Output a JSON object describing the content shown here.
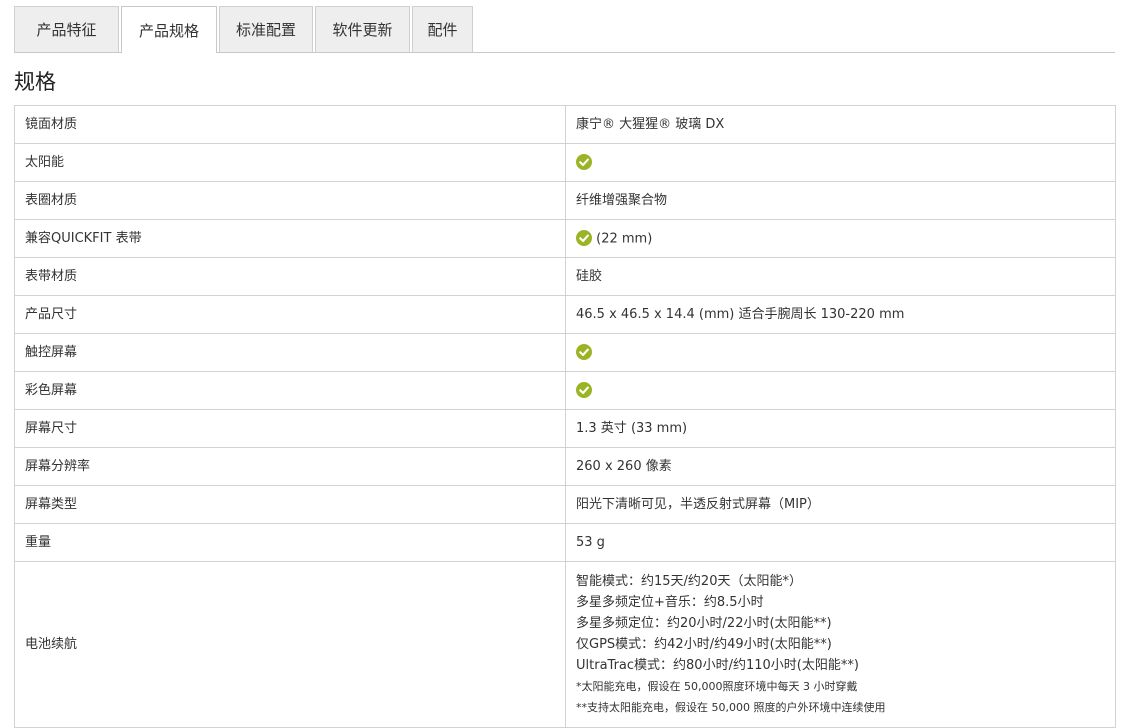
{
  "tabs": [
    {
      "label": "产品特征",
      "active": false
    },
    {
      "label": "产品规格",
      "active": true
    },
    {
      "label": "标准配置",
      "active": false
    },
    {
      "label": "软件更新",
      "active": false
    },
    {
      "label": "配件",
      "active": false
    }
  ],
  "section_title": "规格",
  "specs": [
    {
      "label": "镜面材质",
      "value": "康宁® 大猩猩® 玻璃 DX",
      "check": false
    },
    {
      "label": "太阳能",
      "value": "",
      "check": true
    },
    {
      "label": "表圈材质",
      "value": "纤维增强聚合物",
      "check": false
    },
    {
      "label": "兼容QUICKFIT 表带",
      "value": "(22 mm)",
      "check": true
    },
    {
      "label": "表带材质",
      "value": "硅胶",
      "check": false
    },
    {
      "label": "产品尺寸",
      "value": "46.5 x 46.5 x 14.4 (mm) 适合手腕周长 130-220 mm",
      "check": false
    },
    {
      "label": "触控屏幕",
      "value": "",
      "check": true
    },
    {
      "label": "彩色屏幕",
      "value": "",
      "check": true
    },
    {
      "label": "屏幕尺寸",
      "value": "1.3 英寸 (33 mm)",
      "check": false
    },
    {
      "label": "屏幕分辨率",
      "value": "260 x 260 像素",
      "check": false
    },
    {
      "label": "屏幕类型",
      "value": "阳光下清晰可见，半透反射式屏幕（MIP）",
      "check": false
    },
    {
      "label": "重量",
      "value": "53 g",
      "check": false
    }
  ],
  "battery": {
    "label": "电池续航",
    "lines": [
      "智能模式：约15天/约20天（太阳能*）",
      "多星多频定位+音乐：约8.5小时",
      "多星多频定位：约20小时/22小时(太阳能**)",
      "仅GPS模式：约42小时/约49小时(太阳能**)",
      "UltraTrac模式：约80小时/约110小时(太阳能**)"
    ],
    "notes": [
      "*太阳能充电，假设在 50,000照度环境中每天 3 小时穿戴",
      "**支持太阳能充电，假设在 50,000 照度的户外环境中连续使用"
    ]
  },
  "colors": {
    "check_green": "#9ab425",
    "border": "#d2d2d2",
    "tab_bg": "#eeeeee"
  },
  "icons": {
    "check": "check-circle-icon"
  }
}
